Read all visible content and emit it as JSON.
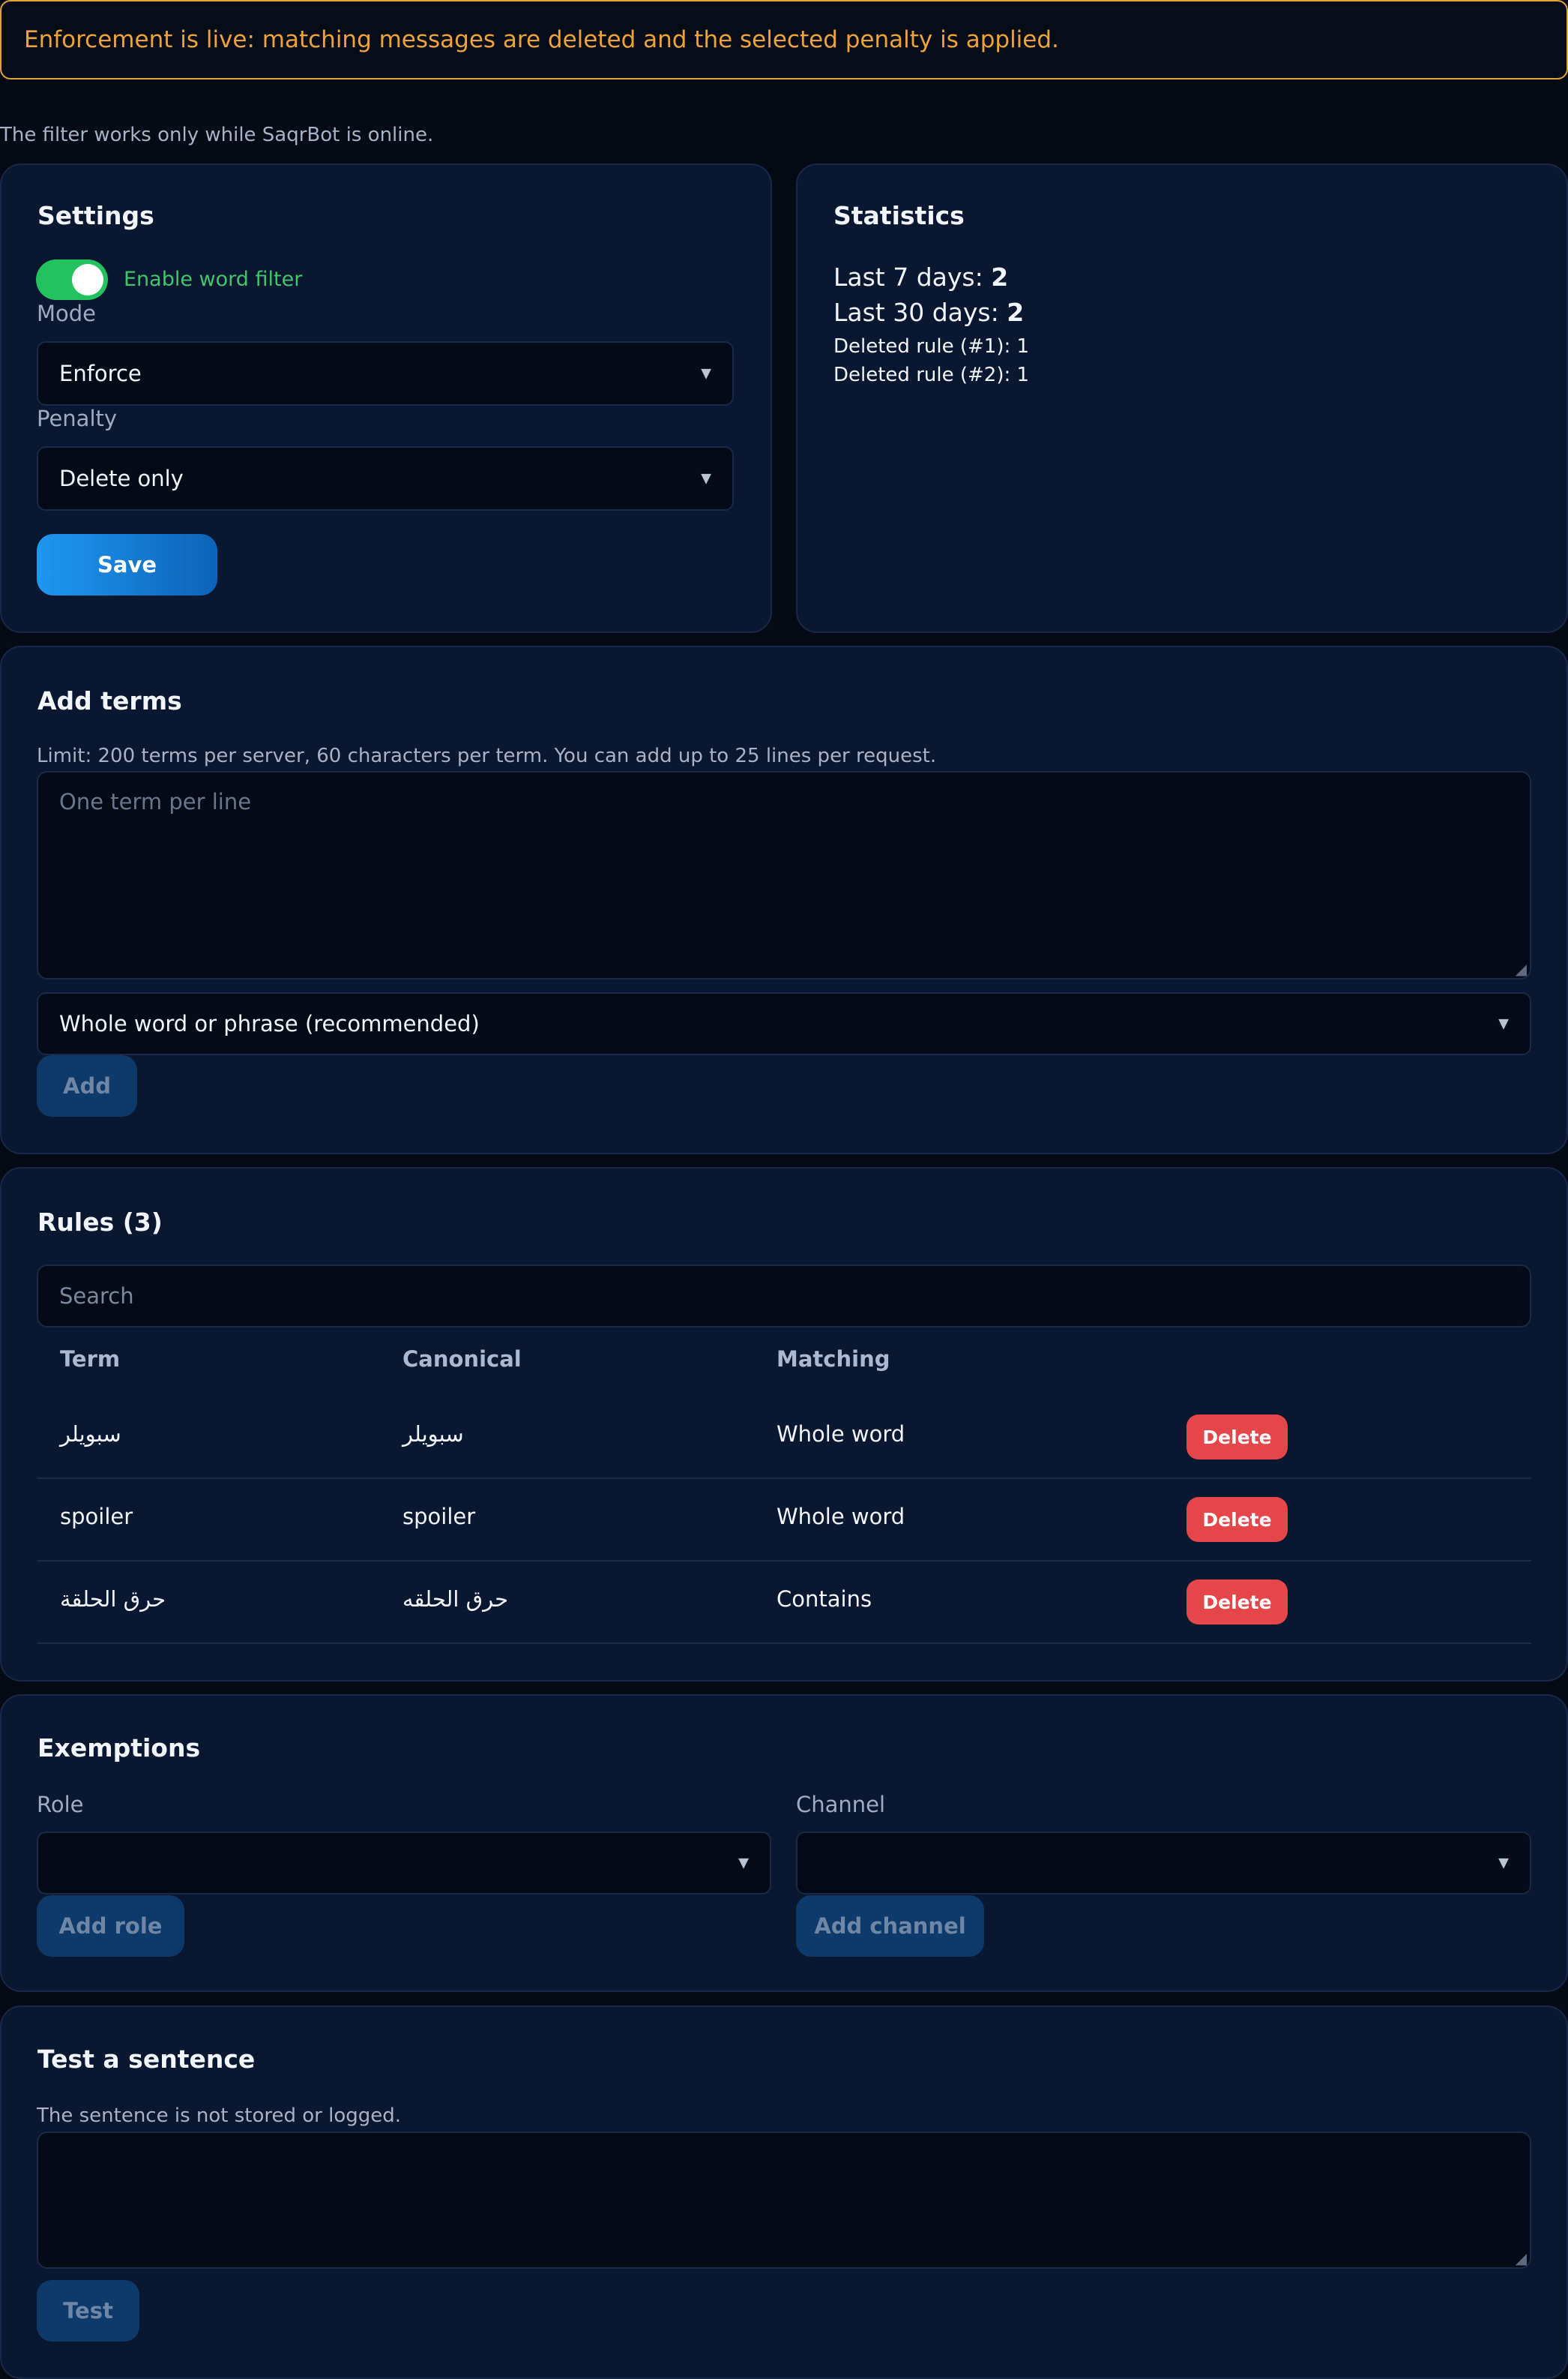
{
  "banner": {
    "text": "Enforcement is live: matching messages are deleted and the selected penalty is applied."
  },
  "note": {
    "text": "The filter works only while SaqrBot is online."
  },
  "settings": {
    "title": "Settings",
    "toggle_label": "Enable word filter",
    "toggle_on": true,
    "mode_label": "Mode",
    "mode_value": "Enforce",
    "penalty_label": "Penalty",
    "penalty_value": "Delete only",
    "save_label": "Save"
  },
  "statistics": {
    "title": "Statistics",
    "last7_label": "Last 7 days:",
    "last7_value": "2",
    "last30_label": "Last 30 days:",
    "last30_value": "2",
    "rule1": "Deleted rule (#1): 1",
    "rule2": "Deleted rule (#2): 1"
  },
  "add_terms": {
    "title": "Add terms",
    "limit_text": "Limit: 200 terms per server, 60 characters per term. You can add up to 25 lines per request.",
    "placeholder": "One term per line",
    "match_mode": "Whole word or phrase (recommended)",
    "add_label": "Add"
  },
  "rules": {
    "title": "Rules (3)",
    "search_placeholder": "Search",
    "columns": {
      "term": "Term",
      "canonical": "Canonical",
      "matching": "Matching"
    },
    "rows": [
      {
        "term": "سبويلر",
        "canonical": "سبويلر",
        "matching": "Whole word",
        "action": "Delete"
      },
      {
        "term": "spoiler",
        "canonical": "spoiler",
        "matching": "Whole word",
        "action": "Delete"
      },
      {
        "term": "حرق الحلقة",
        "canonical": "حرق الحلقه",
        "matching": "Contains",
        "action": "Delete"
      }
    ]
  },
  "exemptions": {
    "title": "Exemptions",
    "role_label": "Role",
    "channel_label": "Channel",
    "add_role_label": "Add role",
    "add_channel_label": "Add channel"
  },
  "test": {
    "title": "Test a sentence",
    "note": "The sentence is not stored or logged.",
    "test_label": "Test"
  },
  "colors": {
    "background": "#050a15",
    "card": "#0a1730",
    "warning": "#eea23a",
    "toggle_on": "#22c35e",
    "primary": "#1f97f0",
    "danger": "#e5464a"
  }
}
